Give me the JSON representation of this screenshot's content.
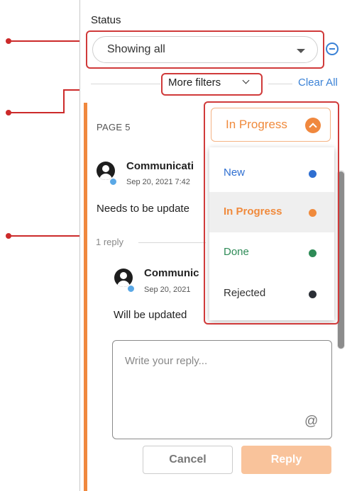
{
  "filter": {
    "status_label": "Status",
    "status_value": "Showing all",
    "more_filters_label": "More filters",
    "clear_all_label": "Clear All"
  },
  "thread": {
    "page_label": "PAGE 5",
    "comment": {
      "author": "Communicati",
      "date": "Sep 20, 2021 7:42",
      "text": "Needs to be update"
    },
    "reply_count": "1 reply",
    "reply": {
      "author": "Communic",
      "date": "Sep 20, 2021",
      "text": "Will be updated"
    },
    "reply_input": {
      "placeholder": "Write your reply...",
      "mention_symbol": "@"
    },
    "buttons": {
      "cancel": "Cancel",
      "reply": "Reply"
    }
  },
  "status_dropdown": {
    "selected": "In Progress",
    "options": [
      {
        "label": "New",
        "color": "#2f6fd1"
      },
      {
        "label": "In Progress",
        "color": "#f08a3c",
        "selected": true
      },
      {
        "label": "Done",
        "color": "#2e8b57"
      },
      {
        "label": "Rejected",
        "color": "#2b2f36"
      }
    ]
  },
  "colors": {
    "accent_orange": "#f0883e",
    "link_blue": "#3b82d6",
    "annotation_red": "#cc2a2a"
  },
  "icons": [
    "minus-circle-icon",
    "chevron-down-icon",
    "chevron-up-icon",
    "avatar-icon",
    "online-status-icon",
    "mention-icon"
  ]
}
